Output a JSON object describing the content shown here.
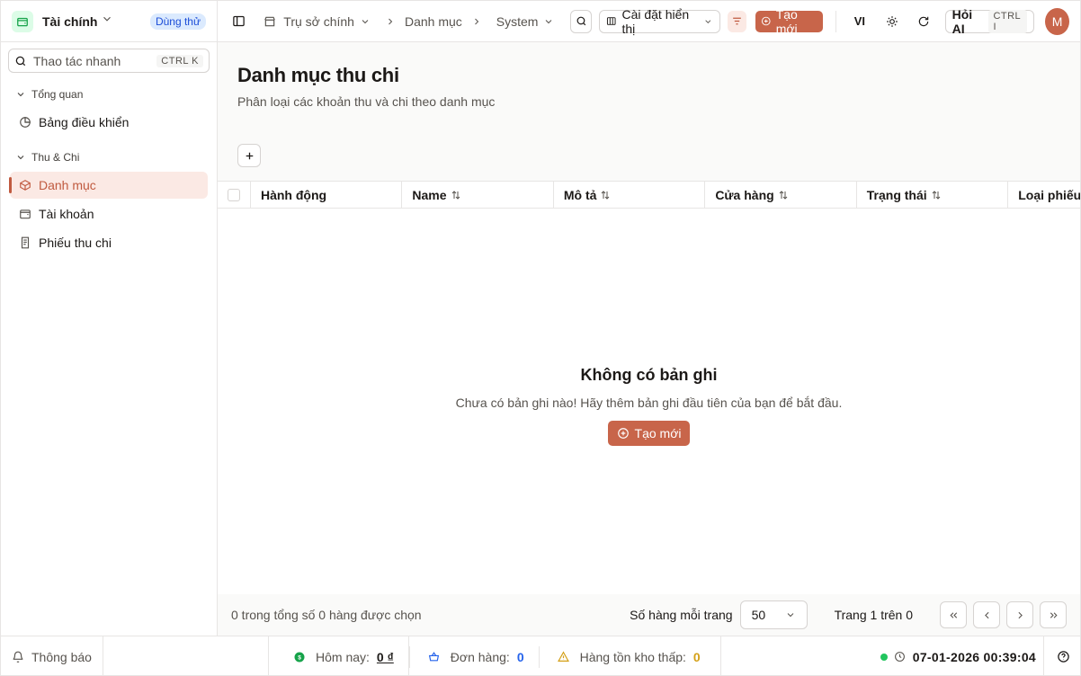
{
  "sidebar": {
    "app_name": "Tài chính",
    "trial_badge": "Dùng thử",
    "quick_search_placeholder": "Thao tác nhanh",
    "quick_search_kbd": "CTRL K",
    "groups": [
      {
        "label": "Tổng quan",
        "items": [
          {
            "label": "Bảng điều khiển",
            "icon": "pie-chart-icon"
          }
        ]
      },
      {
        "label": "Thu & Chi",
        "items": [
          {
            "label": "Danh mục",
            "icon": "box-icon",
            "active": true
          },
          {
            "label": "Tài khoản",
            "icon": "wallet-icon"
          },
          {
            "label": "Phiếu thu chi",
            "icon": "receipt-icon"
          }
        ]
      }
    ]
  },
  "topbar": {
    "breadcrumb": [
      "Trụ sở chính",
      "Danh mục",
      "System"
    ],
    "display_settings": "Cài đặt hiển thị",
    "create": "Tạo mới",
    "language": "VI",
    "ask_ai": "Hỏi AI",
    "ask_ai_kbd": "CTRL I",
    "avatar": "M"
  },
  "page": {
    "title": "Danh mục thu chi",
    "subtitle": "Phân loại các khoản thu và chi theo danh mục"
  },
  "table": {
    "columns": [
      "Hành động",
      "Name",
      "Mô tả",
      "Cửa hàng",
      "Trạng thái",
      "Loại phiếu"
    ],
    "empty_title": "Không có bản ghi",
    "empty_desc": "Chưa có bản ghi nào! Hãy thêm bản ghi đầu tiên của bạn để bắt đầu.",
    "empty_create": "Tạo mới"
  },
  "pagination": {
    "selected_text": "0 trong tổng số 0 hàng được chọn",
    "rows_per_page_label": "Số hàng mỗi trang",
    "rows_per_page": "50",
    "page_text": "Trang 1 trên 0"
  },
  "statusbar": {
    "notifications": "Thông báo",
    "today_label": "Hôm nay:",
    "today_value": "0 ₫",
    "orders_label": "Đơn hàng:",
    "orders_value": "0",
    "low_stock_label": "Hàng tồn kho thấp:",
    "low_stock_value": "0",
    "datetime": "07-01-2026 00:39:04"
  },
  "colors": {
    "accent": "#c8654a",
    "online": "#22c55e",
    "orders": "#2563eb",
    "warning": "#d4a017"
  }
}
